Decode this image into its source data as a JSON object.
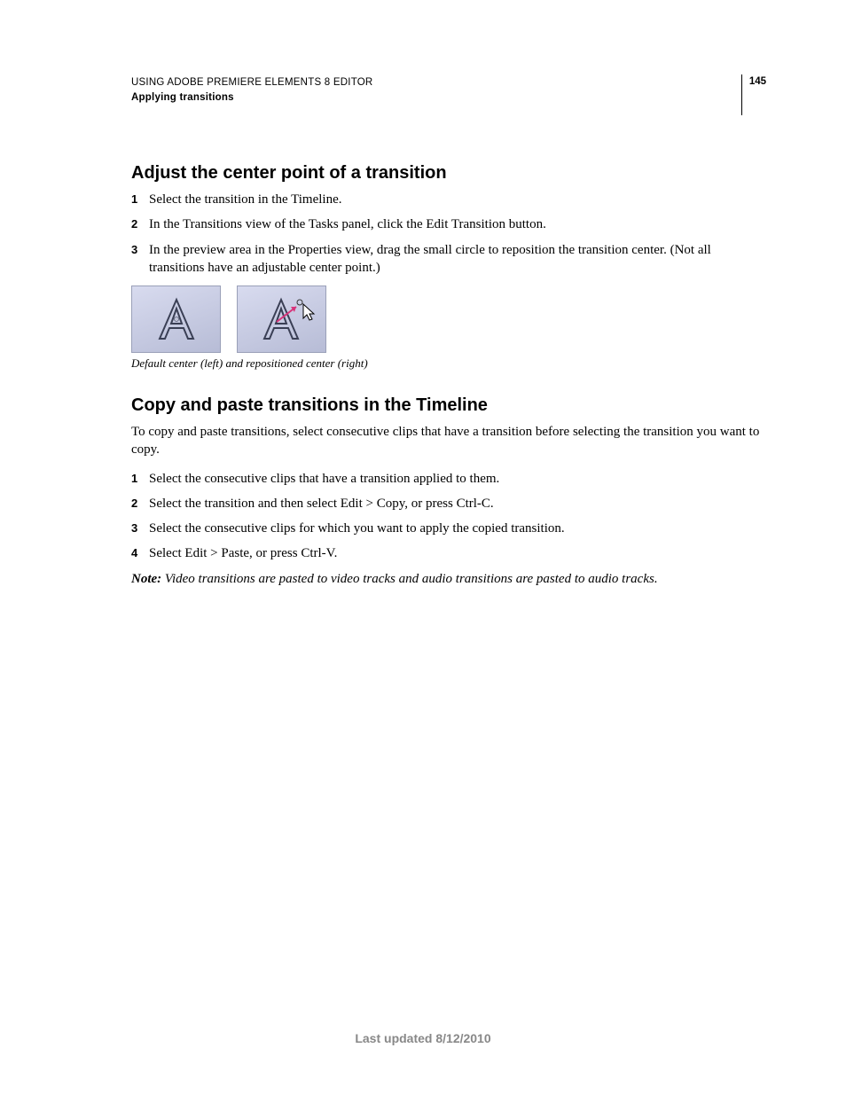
{
  "header": {
    "doc_title": "USING ADOBE PREMIERE ELEMENTS 8 EDITOR",
    "section": "Applying transitions",
    "page_number": "145"
  },
  "section1": {
    "heading": "Adjust the center point of a transition",
    "steps": [
      "Select the transition in the Timeline.",
      "In the Transitions view of the Tasks panel, click the Edit Transition button.",
      "In the preview area in the Properties view, drag the small circle to reposition the transition center. (Not all transitions have an adjustable center point.)"
    ],
    "caption": "Default center (left) and repositioned center (right)"
  },
  "section2": {
    "heading": "Copy and paste transitions in the Timeline",
    "intro": "To copy and paste transitions, select consecutive clips that have a transition before selecting the transition you want to copy.",
    "steps": [
      "Select the consecutive clips that have a transition applied to them.",
      "Select the transition and then select Edit > Copy, or press Ctrl-C.",
      "Select the consecutive clips for which you want to apply the copied transition.",
      "Select Edit > Paste, or press Ctrl-V."
    ],
    "note_label": "Note:",
    "note_text": " Video transitions are pasted to video tracks and audio transitions are pasted to audio tracks."
  },
  "footer": "Last updated 8/12/2010"
}
